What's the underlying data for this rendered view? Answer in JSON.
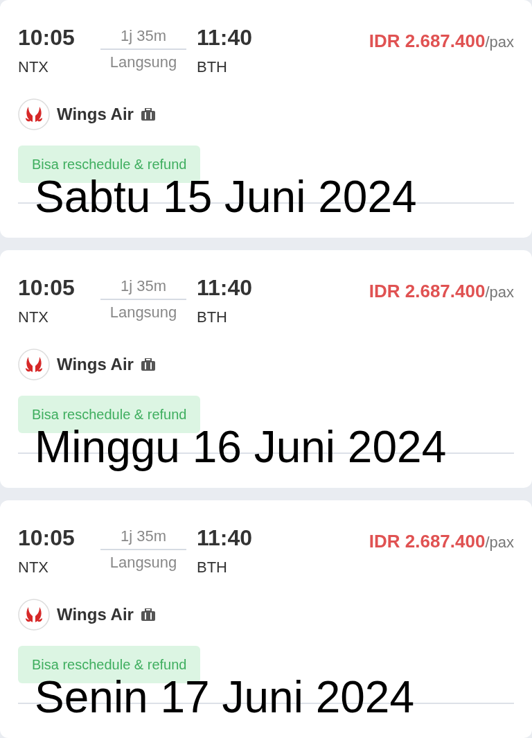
{
  "flights": [
    {
      "depart_time": "10:05",
      "duration": "1j 35m",
      "arrive_time": "11:40",
      "origin": "NTX",
      "stop_type": "Langsung",
      "destination": "BTH",
      "price": "IDR 2.687.400",
      "price_unit": "/pax",
      "airline": "Wings Air",
      "badge": "Bisa reschedule & refund",
      "overlay_date": "Sabtu 15 Juni 2024"
    },
    {
      "depart_time": "10:05",
      "duration": "1j 35m",
      "arrive_time": "11:40",
      "origin": "NTX",
      "stop_type": "Langsung",
      "destination": "BTH",
      "price": "IDR 2.687.400",
      "price_unit": "/pax",
      "airline": "Wings Air",
      "badge": "Bisa reschedule & refund",
      "overlay_date": "Minggu 16 Juni 2024"
    },
    {
      "depart_time": "10:05",
      "duration": "1j 35m",
      "arrive_time": "11:40",
      "origin": "NTX",
      "stop_type": "Langsung",
      "destination": "BTH",
      "price": "IDR 2.687.400",
      "price_unit": "/pax",
      "airline": "Wings Air",
      "badge": "Bisa reschedule & refund",
      "overlay_date": "Senin 17 Juni 2024"
    }
  ]
}
